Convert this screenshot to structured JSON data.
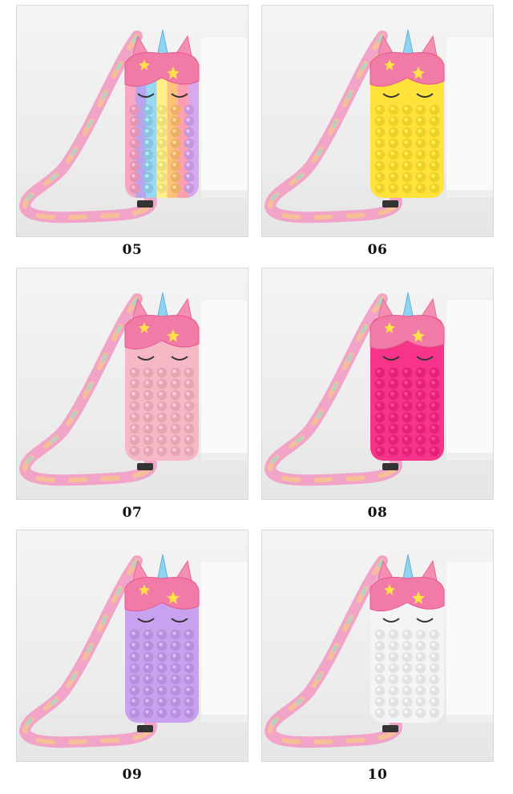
{
  "products": [
    {
      "number": "05",
      "color": "rainbow",
      "body_colors": [
        "#f7a6c4",
        "#b9a4ee",
        "#9ad8f2",
        "#fff08a",
        "#ffc27a",
        "#ff9fb0",
        "#d7a9ee"
      ]
    },
    {
      "number": "06",
      "color": "yellow",
      "body_colors": [
        "#ffe33a"
      ]
    },
    {
      "number": "07",
      "color": "light-pink",
      "body_colors": [
        "#f7b8c6"
      ]
    },
    {
      "number": "08",
      "color": "hot-pink",
      "body_colors": [
        "#f7348a"
      ]
    },
    {
      "number": "09",
      "color": "lavender",
      "body_colors": [
        "#c9a2ef"
      ]
    },
    {
      "number": "10",
      "color": "white",
      "body_colors": [
        "#f4f4f6"
      ]
    }
  ]
}
